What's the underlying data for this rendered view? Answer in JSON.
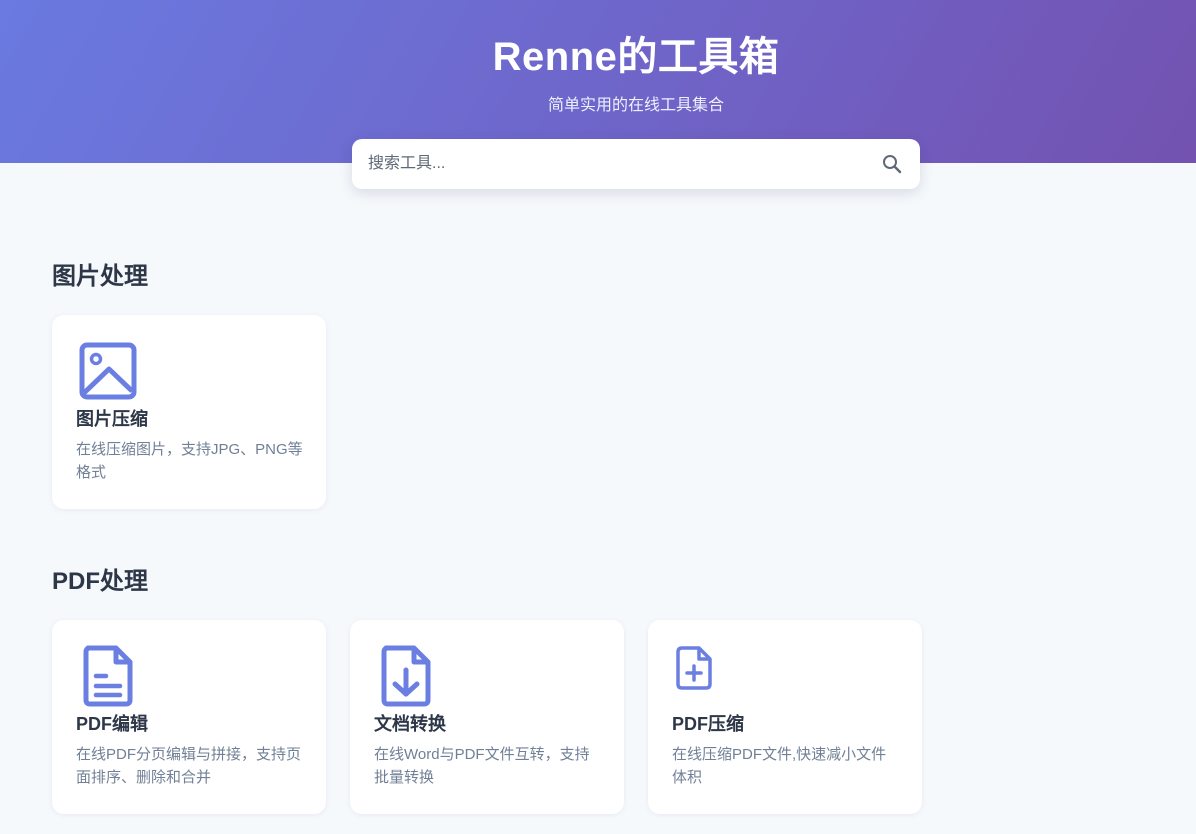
{
  "header": {
    "title": "Renne的工具箱",
    "subtitle": "简单实用的在线工具集合"
  },
  "search": {
    "placeholder": "搜索工具...",
    "value": "",
    "icon": "search-icon"
  },
  "colors": {
    "accent": "#6b7fe3",
    "gradient_start": "#6a7ae0",
    "gradient_end": "#7352b0",
    "background": "#f6f9fc",
    "heading_text": "#2d3748",
    "muted_text": "#718096"
  },
  "sections": [
    {
      "title": "图片处理",
      "tools": [
        {
          "icon": "image-icon",
          "name": "图片压缩",
          "description": "在线压缩图片，支持JPG、PNG等格式"
        }
      ]
    },
    {
      "title": "PDF处理",
      "tools": [
        {
          "icon": "document-text-icon",
          "name": "PDF编辑",
          "description": "在线PDF分页编辑与拼接，支持页面排序、删除和合并"
        },
        {
          "icon": "document-download-icon",
          "name": "文档转换",
          "description": "在线Word与PDF文件互转，支持批量转换"
        },
        {
          "icon": "document-add-icon",
          "name": "PDF压缩",
          "description": "在线压缩PDF文件,快速减小文件体积"
        }
      ]
    }
  ]
}
